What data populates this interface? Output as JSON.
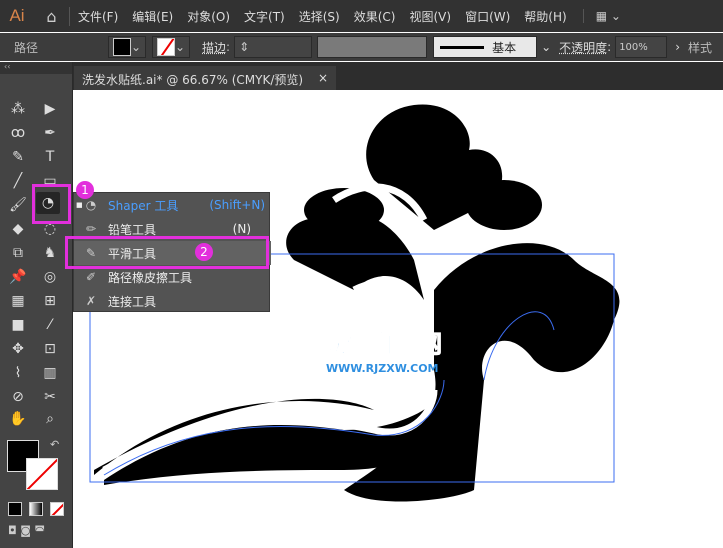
{
  "app": {
    "logo": "Ai",
    "home_icon": "home-icon"
  },
  "menu": [
    "文件(F)",
    "编辑(E)",
    "对象(O)",
    "文字(T)",
    "选择(S)",
    "效果(C)",
    "视图(V)",
    "窗口(W)",
    "帮助(H)"
  ],
  "control": {
    "selection_label": "路径",
    "stroke_label": "描边",
    "brush_label": "基本",
    "opacity_label": "不透明度",
    "opacity_value": "100%",
    "style_label": "样式"
  },
  "document": {
    "tab_title": "洗发水贴纸.ai* @ 66.67% (CMYK/预览)",
    "close": "×"
  },
  "flyout": {
    "items": [
      {
        "label": "Shaper 工具",
        "shortcut": "(Shift+N)",
        "active": true
      },
      {
        "label": "铅笔工具",
        "shortcut": "(N)"
      },
      {
        "label": "平滑工具",
        "shortcut": ""
      },
      {
        "label": "路径橡皮擦工具",
        "shortcut": ""
      },
      {
        "label": "连接工具",
        "shortcut": ""
      }
    ]
  },
  "annotations": {
    "step1": "1",
    "step2": "2"
  },
  "watermark": {
    "title": "软件自学网",
    "url": "WWW.RJZXW.COM"
  },
  "colors": {
    "accent": "#e22fdc",
    "selection": "#3b6cf0",
    "active_item": "#4a9eff"
  }
}
